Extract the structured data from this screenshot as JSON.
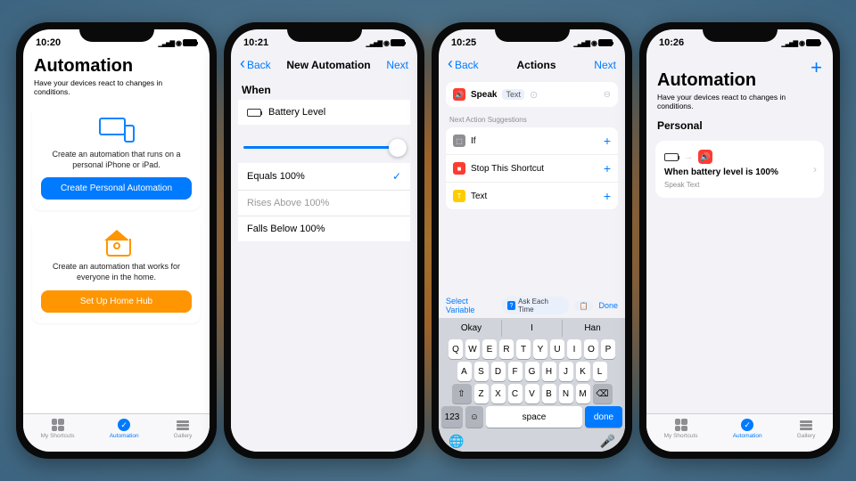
{
  "screen1": {
    "time": "10:20",
    "title": "Automation",
    "subtitle": "Have your devices react to changes in conditions.",
    "personal_desc": "Create an automation that runs on a personal iPhone or iPad.",
    "personal_btn": "Create Personal Automation",
    "home_desc": "Create an automation that works for everyone in the home.",
    "home_btn": "Set Up Home Hub",
    "tabs": [
      "My Shortcuts",
      "Automation",
      "Gallery"
    ]
  },
  "screen2": {
    "time": "10:21",
    "back": "Back",
    "title": "New Automation",
    "next": "Next",
    "when": "When",
    "trigger": "Battery Level",
    "options": [
      {
        "label": "Equals 100%",
        "checked": true
      },
      {
        "label": "Rises Above 100%",
        "checked": false
      },
      {
        "label": "Falls Below 100%",
        "checked": false
      }
    ]
  },
  "screen3": {
    "time": "10:25",
    "back": "Back",
    "title": "Actions",
    "next": "Next",
    "speak": "Speak",
    "speak_placeholder": "Text",
    "sugg_header": "Next Action Suggestions",
    "suggestions": [
      "If",
      "Stop This Shortcut",
      "Text"
    ],
    "acc_select": "Select Variable",
    "acc_ask": "Ask Each Time",
    "acc_done": "Done",
    "predictions": [
      "Okay",
      "I",
      "Han"
    ],
    "krow1": [
      "Q",
      "W",
      "E",
      "R",
      "T",
      "Y",
      "U",
      "I",
      "O",
      "P"
    ],
    "krow2": [
      "A",
      "S",
      "D",
      "F",
      "G",
      "H",
      "J",
      "K",
      "L"
    ],
    "krow3": [
      "Z",
      "X",
      "C",
      "V",
      "B",
      "N",
      "M"
    ],
    "k123": "123",
    "kspace": "space",
    "kdone": "done"
  },
  "screen4": {
    "time": "10:26",
    "title": "Automation",
    "subtitle": "Have your devices react to changes in conditions.",
    "section": "Personal",
    "item_title": "When battery level is 100%",
    "item_sub": "Speak Text",
    "tabs": [
      "My Shortcuts",
      "Automation",
      "Gallery"
    ]
  }
}
